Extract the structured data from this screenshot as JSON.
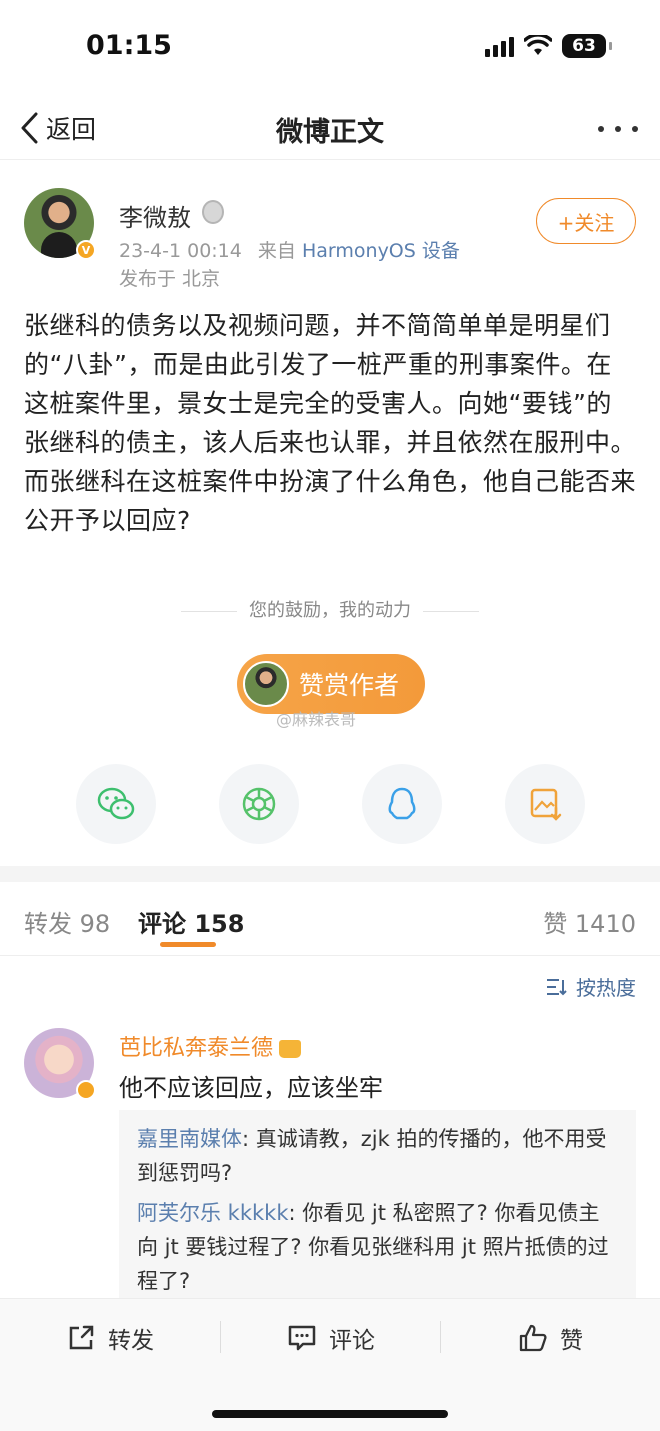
{
  "status_bar": {
    "time": "01:15",
    "battery": "63"
  },
  "nav": {
    "back_label": "返回",
    "title": "微博正文"
  },
  "author": {
    "name": "李微敖",
    "timestamp": "23-4-1 00:14",
    "source_prefix": "来自",
    "device": "HarmonyOS 设备",
    "location": "发布于 北京",
    "follow_label": "+关注"
  },
  "post": {
    "text": "张继科的债务以及视频问题，并不简简单单是明星们的“八卦”，而是由此引发了一桩严重的刑事案件。在这桩案件里，景女士是完全的受害人。向她“要钱”的张继科的债主，该人后来也认罪，并且依然在服刑中。而张继科在这桩案件中扮演了什么角色，他自己能否来公开予以回应?"
  },
  "reward": {
    "hint": "您的鼓励，我的动力",
    "button_label": "赞赏作者",
    "watermark": "@麻辣表哥"
  },
  "share": [
    {
      "icon": "wechat-icon",
      "color": "#3dbf6e"
    },
    {
      "icon": "moments-icon",
      "color": "#55c26a"
    },
    {
      "icon": "qq-icon",
      "color": "#3aa0e8"
    },
    {
      "icon": "save-image-icon",
      "color": "#f0a33a"
    }
  ],
  "tabs": {
    "repost": "转发 98",
    "comments": "评论 158",
    "likes": "赞 1410"
  },
  "sort_label": "按热度",
  "comment": {
    "user": "芭比私奔泰兰德",
    "text": "他不应该回应，应该坐牢",
    "replies": [
      {
        "user": "嘉里南媒体",
        "text": ": 真诚请教，zjk 拍的传播的，他不用受到惩罚吗?"
      },
      {
        "user": "阿芙尔乐 kkkkk",
        "text": ": 你看见 jt 私密照了? 你看见债主向 jt 要钱过程了? 你看见张继科用 jt 照片抵债的过程了?"
      }
    ]
  },
  "bottom_bar": {
    "repost": "转发",
    "comment": "评论",
    "like": "赞"
  }
}
